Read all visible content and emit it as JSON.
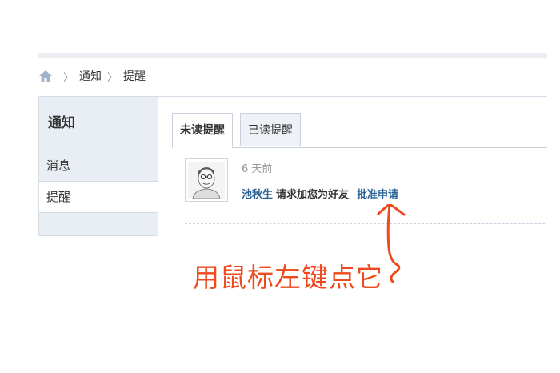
{
  "breadcrumb": {
    "items": [
      "通知",
      "提醒"
    ],
    "separator": "〉"
  },
  "sidebar": {
    "title": "通知",
    "items": [
      {
        "label": "消息",
        "active": false
      },
      {
        "label": "提醒",
        "active": true
      }
    ]
  },
  "tabs": [
    {
      "label": "未读提醒",
      "active": true
    },
    {
      "label": "已读提醒",
      "active": false
    }
  ],
  "notification": {
    "time": "6 天前",
    "user": "池秋生",
    "message": "请求加您为好友",
    "action": "批准申请"
  },
  "annotation": {
    "text": "用鼠标左键点它",
    "color": "#ee4a1e"
  },
  "colors": {
    "link": "#2b6295",
    "sidebar_bg": "#e9eef4",
    "border": "#c9d2dc"
  },
  "icons": {
    "home": "home-icon",
    "avatar": "user-avatar",
    "arrow": "up-arrow"
  }
}
